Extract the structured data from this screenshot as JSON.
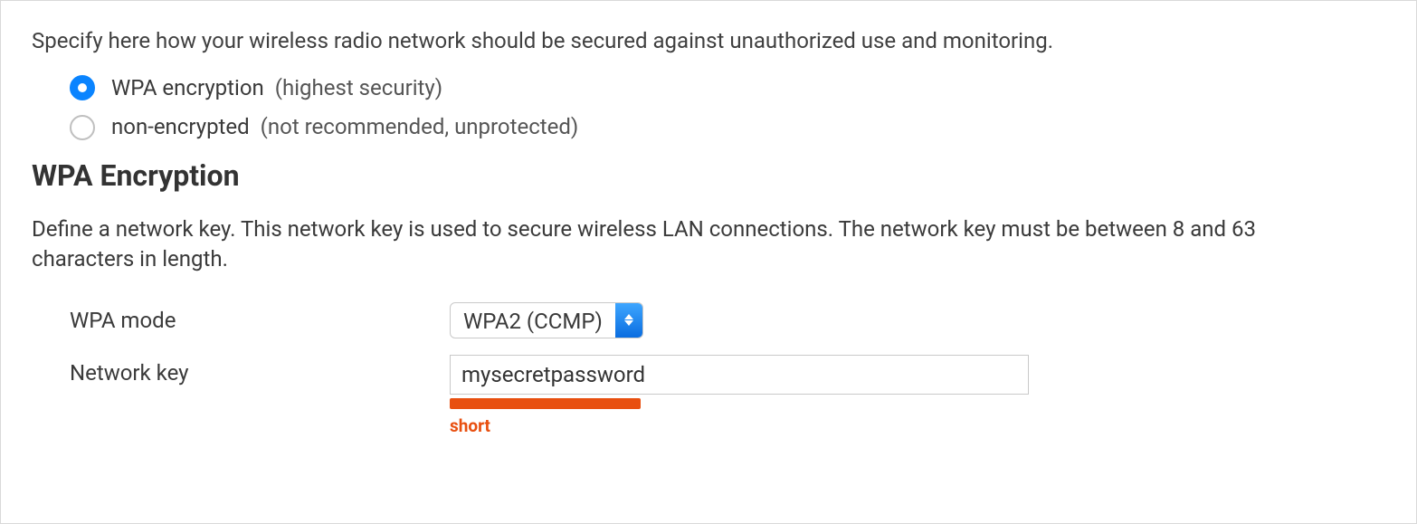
{
  "intro": "Specify here how your wireless radio network should be secured against unauthorized use and monitoring.",
  "radios": {
    "items": [
      {
        "label": "WPA encryption",
        "hint": "(highest security)",
        "selected": true
      },
      {
        "label": "non-encrypted",
        "hint": "(not recommended, unprotected)",
        "selected": false
      }
    ]
  },
  "section": {
    "title": "WPA Encryption",
    "desc": "Define a network key. This network key is used to secure wireless LAN connections. The network key must be between 8 and 63 characters in length."
  },
  "form": {
    "wpa_mode": {
      "label": "WPA mode",
      "value": "WPA2 (CCMP)"
    },
    "network_key": {
      "label": "Network key",
      "value": "mysecretpassword"
    },
    "strength": {
      "label": "short",
      "percent": 33,
      "color": "#e84f0f"
    }
  }
}
